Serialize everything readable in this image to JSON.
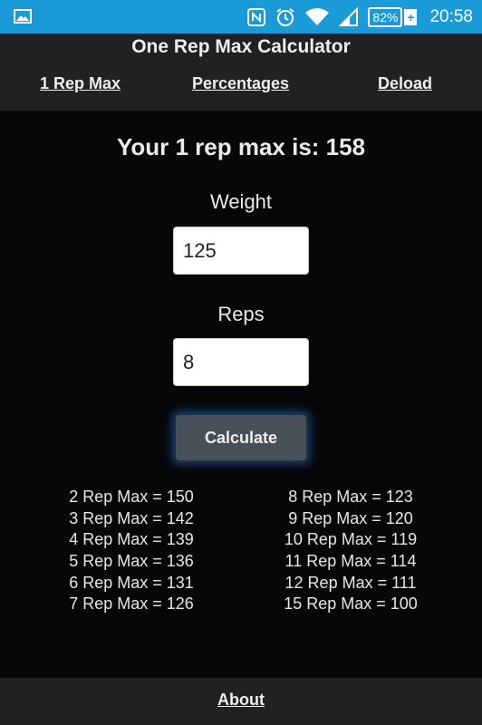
{
  "status_bar": {
    "icons": [
      "image-icon",
      "nfc-icon",
      "alarm-icon",
      "wifi-icon",
      "signal-icon"
    ],
    "battery": "82%",
    "time": "20:58"
  },
  "header": {
    "title": "One Rep Max Calculator",
    "nav": [
      {
        "label": "1 Rep Max"
      },
      {
        "label": "Percentages"
      },
      {
        "label": "Deload"
      }
    ]
  },
  "main": {
    "result": "Your 1 rep max is: 158",
    "weight_label": "Weight",
    "weight_value": "125",
    "reps_label": "Reps",
    "reps_value": "8",
    "calculate_label": "Calculate",
    "left_col": [
      "2 Rep Max = 150",
      "3 Rep Max = 142",
      "4 Rep Max = 139",
      "5 Rep Max = 136",
      "6 Rep Max = 131",
      "7 Rep Max = 126"
    ],
    "right_col": [
      "8 Rep Max = 123",
      "9 Rep Max = 120",
      "10 Rep Max = 119",
      "11 Rep Max = 114",
      "12 Rep Max = 111",
      "15 Rep Max = 100"
    ]
  },
  "footer": {
    "about_label": "About"
  },
  "colors": {
    "status_bar": "#1b9ad8",
    "header_bg": "#1f2123",
    "page_bg": "#070709",
    "button_bg": "#474f59",
    "button_glow": "#2878dc"
  }
}
